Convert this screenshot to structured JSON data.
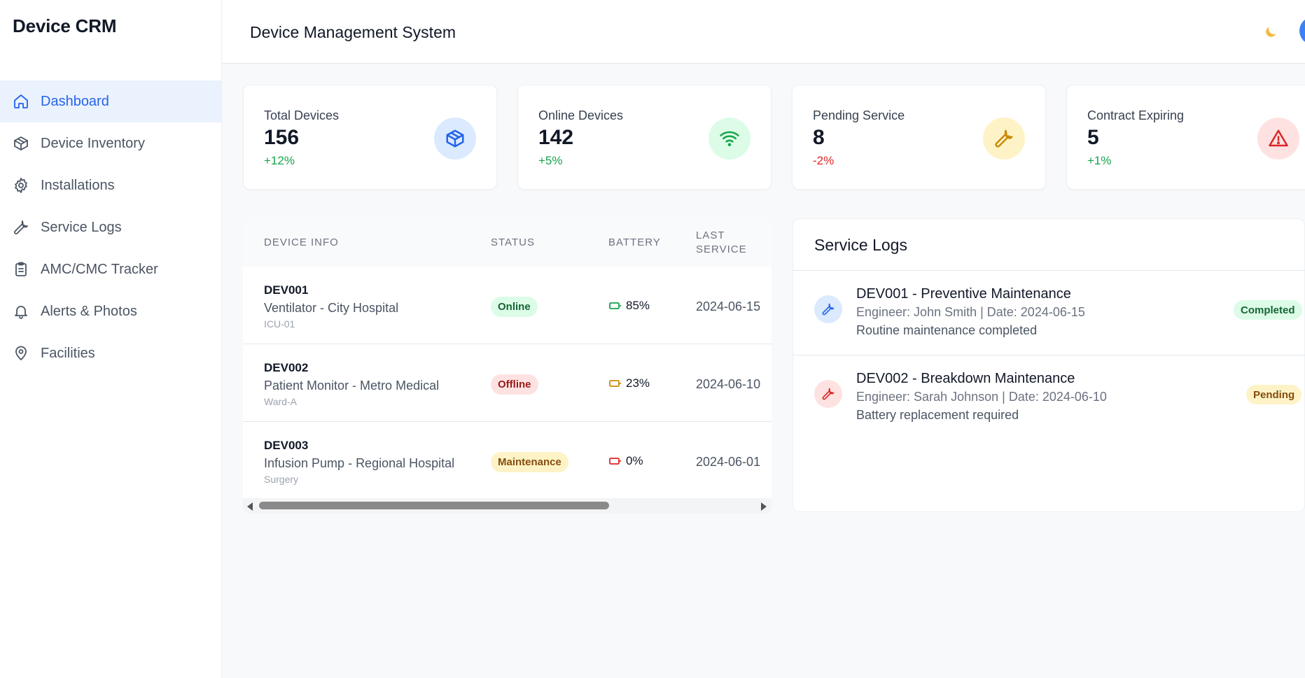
{
  "sidebar": {
    "brand": "Device CRM",
    "items": [
      {
        "label": "Dashboard",
        "icon": "home-icon",
        "active": true
      },
      {
        "label": "Device Inventory",
        "icon": "box-icon"
      },
      {
        "label": "Installations",
        "icon": "gear-icon"
      },
      {
        "label": "Service Logs",
        "icon": "wrench-icon"
      },
      {
        "label": "AMC/CMC Tracker",
        "icon": "clipboard-icon"
      },
      {
        "label": "Alerts & Photos",
        "icon": "bell-icon"
      },
      {
        "label": "Facilities",
        "icon": "map-pin-icon"
      }
    ]
  },
  "header": {
    "title": "Device Management System",
    "theme_icon": "moon-icon",
    "avatar_color": "#3b82f6"
  },
  "stats": [
    {
      "label": "Total Devices",
      "value": "156",
      "change": "+12%",
      "trend": "up",
      "icon": "box-icon",
      "icon_bg": "#dbeafe",
      "icon_color": "#2563eb"
    },
    {
      "label": "Online Devices",
      "value": "142",
      "change": "+5%",
      "trend": "up",
      "icon": "wifi-icon",
      "icon_bg": "#dcfce7",
      "icon_color": "#16a34a"
    },
    {
      "label": "Pending Service",
      "value": "8",
      "change": "-2%",
      "trend": "down",
      "icon": "wrench-icon",
      "icon_bg": "#fef3c7",
      "icon_color": "#ca8a04"
    },
    {
      "label": "Contract Expiring",
      "value": "5",
      "change": "+1%",
      "trend": "up",
      "icon": "alert-triangle-icon",
      "icon_bg": "#fee2e2",
      "icon_color": "#dc2626"
    }
  ],
  "table": {
    "columns": [
      "DEVICE INFO",
      "STATUS",
      "BATTERY",
      "LAST",
      "SERVICE"
    ],
    "rows": [
      {
        "id": "DEV001",
        "name": "Ventilator - City Hospital",
        "location": "ICU-01",
        "status": "Online",
        "battery": "85%",
        "last_service": "2024-06-15"
      },
      {
        "id": "DEV002",
        "name": "Patient Monitor - Metro Medical",
        "location": "Ward-A",
        "status": "Offline",
        "battery": "23%",
        "last_service": "2024-06-10"
      },
      {
        "id": "DEV003",
        "name": "Infusion Pump - Regional Hospital",
        "location": "Surgery",
        "status": "Maintenance",
        "battery": "0%",
        "last_service": "2024-06-01"
      }
    ]
  },
  "service_logs": {
    "title": "Service Logs",
    "items": [
      {
        "title": "DEV001 - Preventive Maintenance",
        "meta": "Engineer: John Smith | Date: 2024-06-15",
        "description": "Routine maintenance completed",
        "status": "Completed"
      },
      {
        "title": "DEV002 - Breakdown Maintenance",
        "meta": "Engineer: Sarah Johnson | Date: 2024-06-10",
        "description": "Battery replacement required",
        "status": "Pending"
      }
    ]
  },
  "colors": {
    "accent": "#2563eb",
    "online": "#16a34a",
    "offline": "#dc2626",
    "maintenance": "#ca8a04"
  }
}
